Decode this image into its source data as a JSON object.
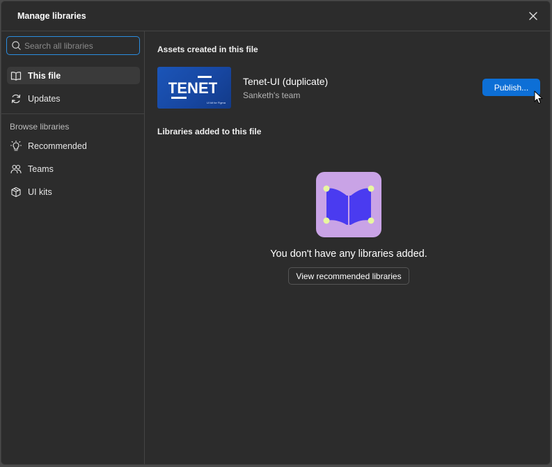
{
  "dialog": {
    "title": "Manage libraries"
  },
  "sidebar": {
    "search_placeholder": "Search all libraries",
    "items": [
      {
        "label": "This file",
        "icon": "book-icon",
        "active": true
      },
      {
        "label": "Updates",
        "icon": "refresh-icon",
        "active": false
      }
    ],
    "browse_label": "Browse libraries",
    "browse_items": [
      {
        "label": "Recommended",
        "icon": "lightbulb-icon"
      },
      {
        "label": "Teams",
        "icon": "people-icon"
      },
      {
        "label": "UI kits",
        "icon": "package-icon"
      }
    ]
  },
  "main": {
    "assets_heading": "Assets created in this file",
    "library": {
      "name": "Tenet-UI (duplicate)",
      "team": "Sanketh's team",
      "thumb_logo": "TENET",
      "thumb_caption": "UI kit for Figma"
    },
    "publish_label": "Publish...",
    "added_heading": "Libraries added to this file",
    "empty_text": "You don't have any libraries added.",
    "view_button": "View recommended libraries"
  },
  "colors": {
    "accent": "#0d6fd6",
    "focus": "#2b8de0",
    "illustration_bg": "#c9a3e6",
    "illustration_book": "#4a3bf0",
    "illustration_handles": "#e8f7a0"
  }
}
